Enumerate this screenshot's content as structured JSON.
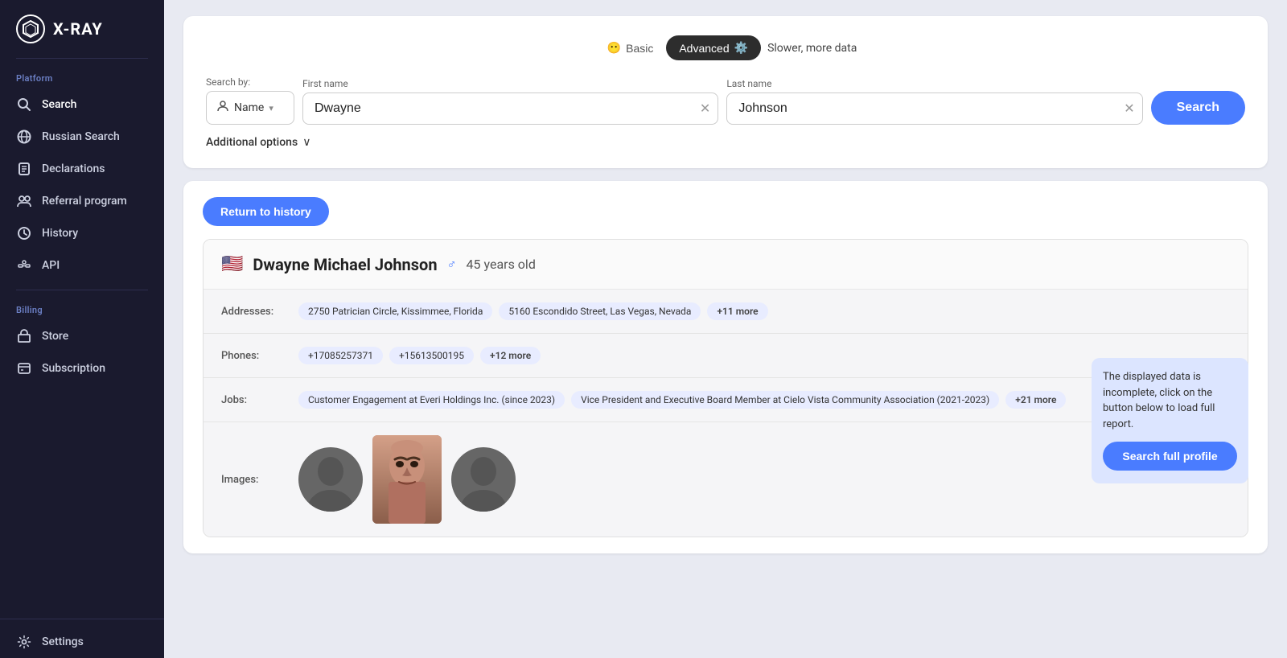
{
  "sidebar": {
    "logo": {
      "icon": "⬡",
      "text": "X-RAY"
    },
    "platform_label": "Platform",
    "billing_label": "Billing",
    "items_platform": [
      {
        "id": "search",
        "label": "Search",
        "icon": "🔍",
        "active": true
      },
      {
        "id": "russian-search",
        "label": "Russian Search",
        "icon": "🌐",
        "active": false
      },
      {
        "id": "declarations",
        "label": "Declarations",
        "icon": "📋",
        "active": false
      },
      {
        "id": "referral-program",
        "label": "Referral program",
        "icon": "👥",
        "active": false
      },
      {
        "id": "history",
        "label": "History",
        "icon": "🕐",
        "active": false
      },
      {
        "id": "api",
        "label": "API",
        "icon": "🔑",
        "active": false
      }
    ],
    "items_billing": [
      {
        "id": "store",
        "label": "Store",
        "icon": "🛒",
        "active": false
      },
      {
        "id": "subscription",
        "label": "Subscription",
        "icon": "📅",
        "active": false
      }
    ],
    "settings_label": "Settings",
    "settings_icon": "⚙️"
  },
  "search_panel": {
    "mode_basic_label": "Basic",
    "mode_advanced_label": "Advanced",
    "mode_slower_text": "Slower, more data",
    "search_by_label": "Search by:",
    "search_by_value": "Name",
    "first_name_label": "First name",
    "first_name_value": "Dwayne",
    "last_name_label": "Last name",
    "last_name_value": "Johnson",
    "search_button_label": "Search",
    "additional_options_label": "Additional options"
  },
  "results": {
    "return_button_label": "Return to history",
    "profile": {
      "flag": "🇺🇸",
      "name": "Dwayne Michael Johnson",
      "gender": "♂",
      "age": "45 years old",
      "addresses_label": "Addresses:",
      "addresses": [
        "2750 Patrician Circle, Kissimmee, Florida",
        "5160 Escondido Street, Las Vegas, Nevada",
        "+11 more"
      ],
      "phones_label": "Phones:",
      "phones": [
        "+17085257371",
        "+15613500195",
        "+12 more"
      ],
      "jobs_label": "Jobs:",
      "jobs": [
        "Customer Engagement at Everi Holdings Inc. (since 2023)",
        "Vice President and Executive Board Member at Cielo Vista Community Association (2021-2023)",
        "+21 more"
      ],
      "images_label": "Images:"
    },
    "callout": {
      "text": "The displayed data is incomplete, click on the button below to load full report.",
      "button_label": "Search full profile"
    }
  }
}
